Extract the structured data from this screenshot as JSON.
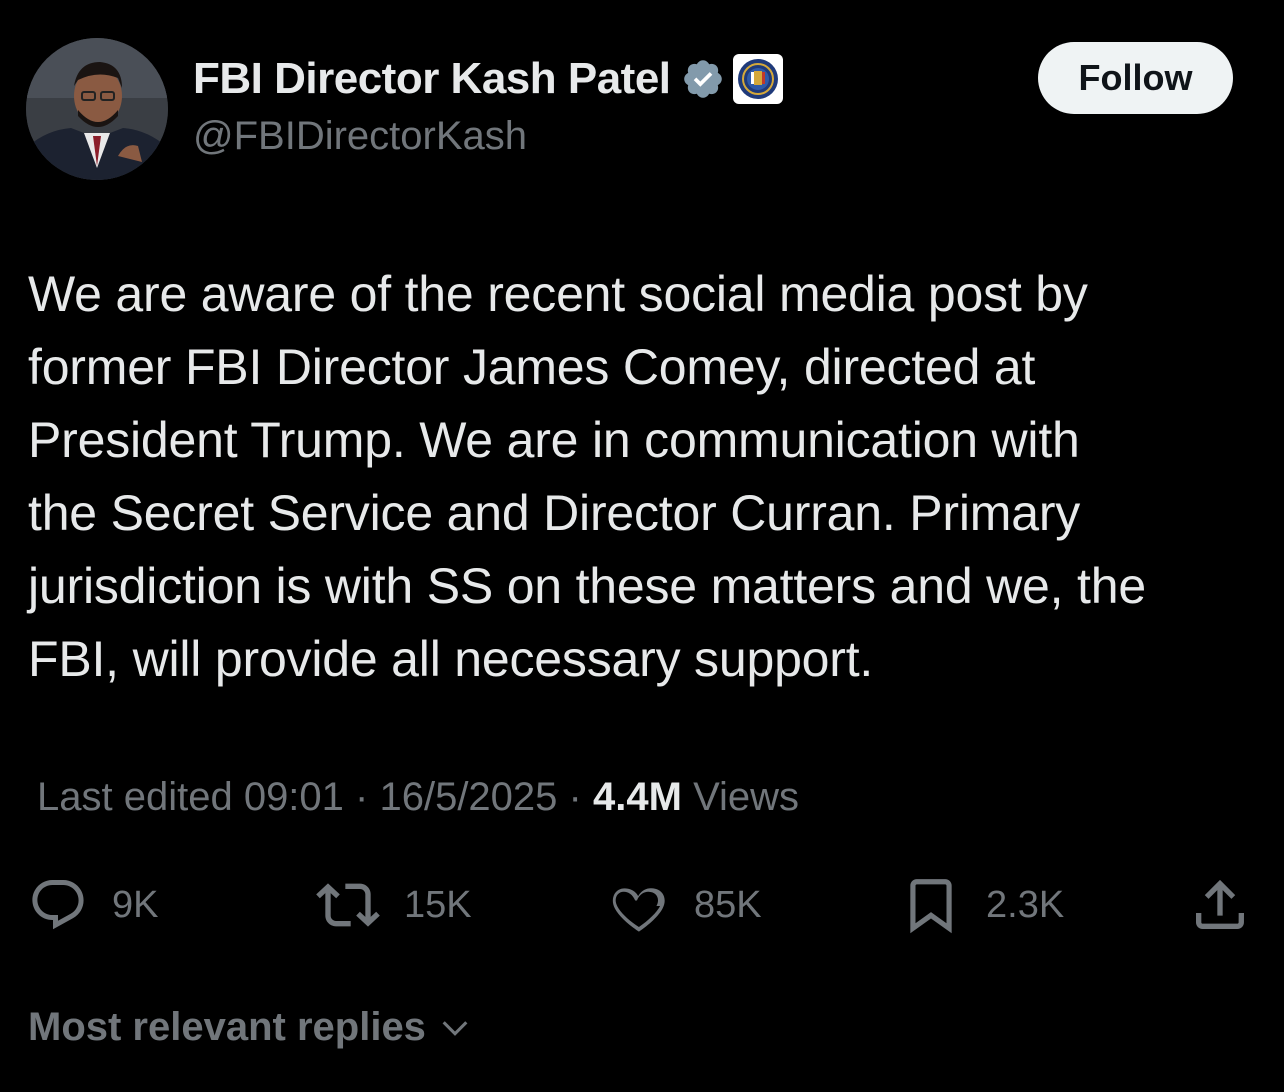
{
  "author": {
    "display_name": "FBI Director Kash Patel",
    "handle": "@FBIDirectorKash",
    "verified": true,
    "affiliate_badge": "fbi-seal-icon"
  },
  "follow_button": {
    "label": "Follow"
  },
  "tweet": {
    "text": "We are aware of the recent social media post by\nformer FBI Director James Comey, directed at\nPresident Trump. We are in communication with\nthe Secret Service and Director Curran. Primary\njurisdiction is with SS on these matters and we, the\nFBI, will provide all necessary support."
  },
  "meta": {
    "edited_label": "Last edited 09:01 · 16/5/2025",
    "separator": "·",
    "views_count": "4.4M",
    "views_label": "Views"
  },
  "actions": {
    "reply": {
      "icon": "reply-icon",
      "count": "9K"
    },
    "repost": {
      "icon": "repost-icon",
      "count": "15K"
    },
    "like": {
      "icon": "heart-icon",
      "count": "85K"
    },
    "bookmark": {
      "icon": "bookmark-icon",
      "count": "2.3K"
    },
    "share": {
      "icon": "share-icon"
    }
  },
  "replies_sort": {
    "label": "Most relevant replies",
    "icon": "chevron-down-icon"
  },
  "colors": {
    "background": "#000000",
    "primary_text": "#e7e9ea",
    "secondary_text": "#71767b",
    "verified_badge": "#829aab",
    "follow_button_bg": "#eff3f4"
  }
}
